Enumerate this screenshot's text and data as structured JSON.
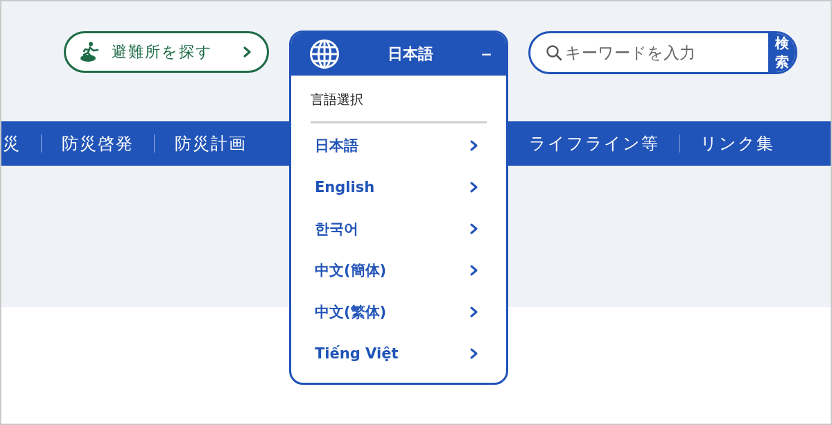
{
  "shelter_button": {
    "label": "避難所を探す"
  },
  "language_menu": {
    "current": "日本語",
    "toggle": "−",
    "expanded": true,
    "heading": "言語選択",
    "options": [
      {
        "label": "日本語"
      },
      {
        "label": "English"
      },
      {
        "label": "한국어"
      },
      {
        "label": "中文(簡体)"
      },
      {
        "label": "中文(繁体)"
      },
      {
        "label": "Tiếng Việt"
      }
    ]
  },
  "search": {
    "placeholder": "キーワードを入力",
    "button": "検索"
  },
  "nav": {
    "left_items": [
      "災",
      "防災啓発",
      "防災計画"
    ],
    "right_items": [
      "ライフライン等",
      "リンク集"
    ]
  }
}
